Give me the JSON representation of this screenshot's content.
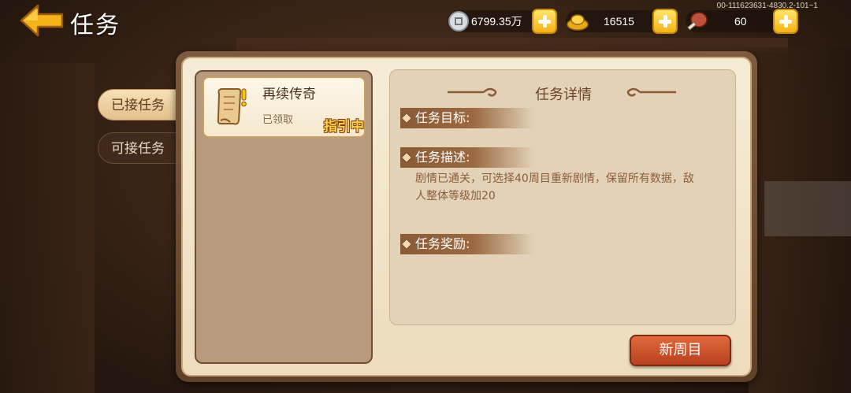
{
  "header": {
    "title": "任务",
    "version": "00-111623631-4830.2-101~1"
  },
  "resources": {
    "silver": {
      "value": "6799.35万",
      "icon": "silver-coin-icon"
    },
    "gold": {
      "value": "16515",
      "icon": "gold-ingot-icon"
    },
    "stamina": {
      "value": "60",
      "icon": "meat-drumstick-icon"
    }
  },
  "tabs": [
    {
      "label": "已接任务",
      "active": true
    },
    {
      "label": "可接任务",
      "active": false
    }
  ],
  "task_list": [
    {
      "name": "再续传奇",
      "status": "已领取",
      "badge": "指引中",
      "icon": "scroll-quest-icon"
    }
  ],
  "detail": {
    "title": "任务详情",
    "goal_label": "任务目标:",
    "description_label": "任务描述:",
    "description": "剧情已通关，可选择40周目重新剧情，保留所有数据，敌人整体等级加20",
    "reward_label": "任务奖励:"
  },
  "actions": {
    "new_cycle_label": "新周目"
  },
  "colors": {
    "accent_orange": "#f5b21b",
    "button_red": "#c8502a",
    "panel_parchment": "#f4e8ce"
  }
}
